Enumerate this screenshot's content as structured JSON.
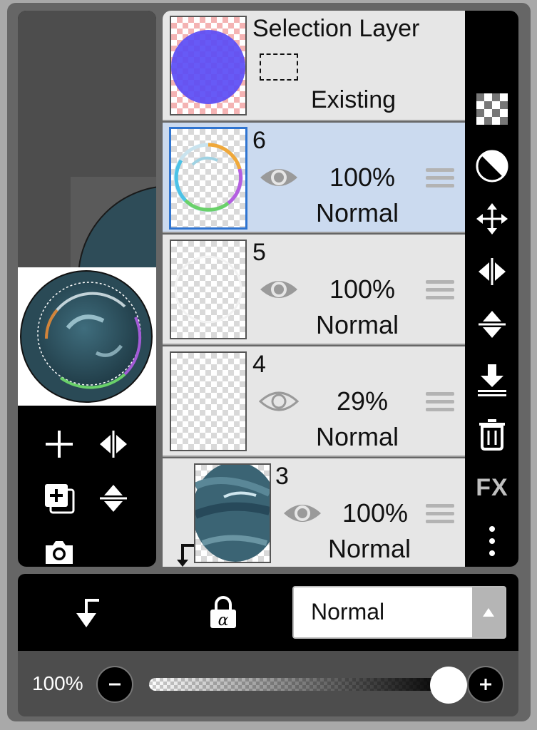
{
  "layer_panel": {
    "selection_layer": {
      "title": "Selection Layer",
      "state": "Existing"
    },
    "layers": [
      {
        "number": "6",
        "opacity": "100%",
        "blend": "Normal",
        "visible": true,
        "selected": true
      },
      {
        "number": "5",
        "opacity": "100%",
        "blend": "Normal",
        "visible": true,
        "selected": false
      },
      {
        "number": "4",
        "opacity": "29%",
        "blend": "Normal",
        "visible": true,
        "selected": false,
        "dimmed_eye": true
      },
      {
        "number": "3",
        "opacity": "100%",
        "blend": "Normal",
        "visible": true,
        "selected": false,
        "clipped": true
      }
    ]
  },
  "left_tools": [
    "add-layer-icon",
    "flip-horizontal-icon",
    "duplicate-layer-icon",
    "flip-vertical-icon",
    "camera-icon"
  ],
  "right_tools": [
    "transparency-icon",
    "contrast-icon",
    "move-icon",
    "flip-horizontal-icon",
    "flip-vertical-icon",
    "merge-down-icon",
    "trash-icon",
    "fx-icon",
    "more-icon"
  ],
  "right_fx_label": "FX",
  "bottom_bar": {
    "blend_mode": "Normal",
    "icons": [
      "clipping-icon",
      "alpha-lock-icon"
    ]
  },
  "opacity_slider": {
    "label": "100%",
    "value": 1.0
  },
  "colors": {
    "selection_highlight": "#cbdaef",
    "selected_thumb_border": "#2f74d0",
    "panel_background": "#666666",
    "toolbar_background": "#000000"
  }
}
